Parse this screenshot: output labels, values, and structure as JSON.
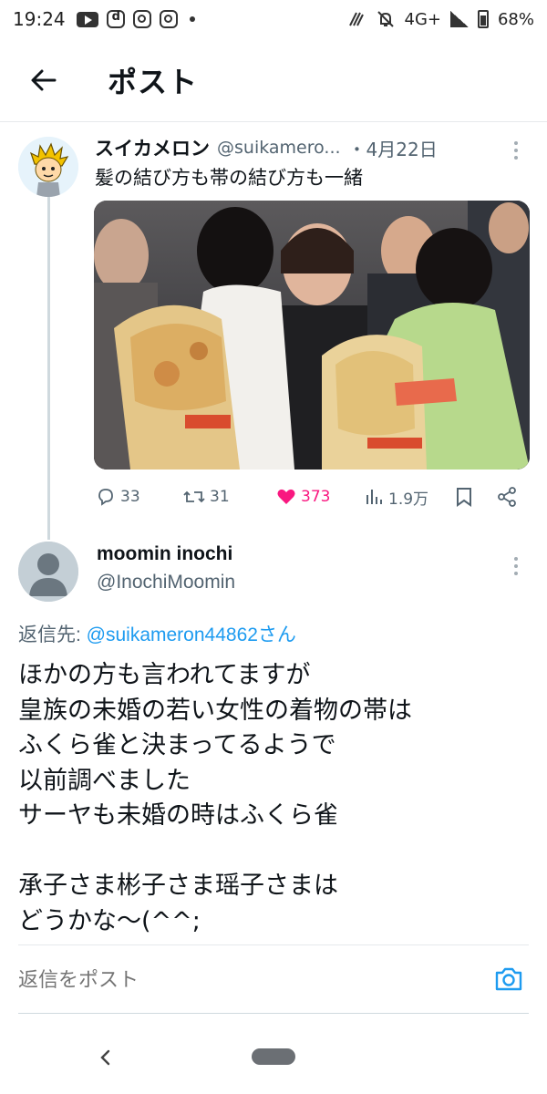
{
  "status_bar": {
    "time": "19:24",
    "network": "4G+",
    "battery": "68%",
    "icons": [
      "youtube-icon",
      "tiktok-icon",
      "instagram-icon",
      "instagram-icon",
      "dot-icon",
      "nfc-icon",
      "mute-icon",
      "signal-icon",
      "battery-icon"
    ]
  },
  "header": {
    "back_icon": "arrow-left-icon",
    "title": "ポスト"
  },
  "tweet1": {
    "name": "スイカメロン",
    "handle": "@suikamero...",
    "date": "・4月22日",
    "text": "髪の結び方も帯の結び方も一緒",
    "actions": {
      "replies": "33",
      "retweets": "31",
      "likes": "373",
      "views": "1.9万"
    }
  },
  "tweet2": {
    "name": "moomin inochi",
    "handle": "@InochiMoomin",
    "reply_prefix": "返信先: ",
    "reply_target": "@suikameron44862さん",
    "text": "ほかの方も言われてますが\n皇族の未婚の若い女性の着物の帯は\nふくら雀と決まってるようで\n以前調べました\nサーヤも未婚の時はふくら雀\n\n承子さま彬子さま瑶子さまは\nどうかな〜(^^;"
  },
  "composer": {
    "placeholder": "返信をポスト"
  },
  "colors": {
    "like_pink": "#f91880",
    "link_blue": "#1d9bf0",
    "muted": "#536471"
  }
}
